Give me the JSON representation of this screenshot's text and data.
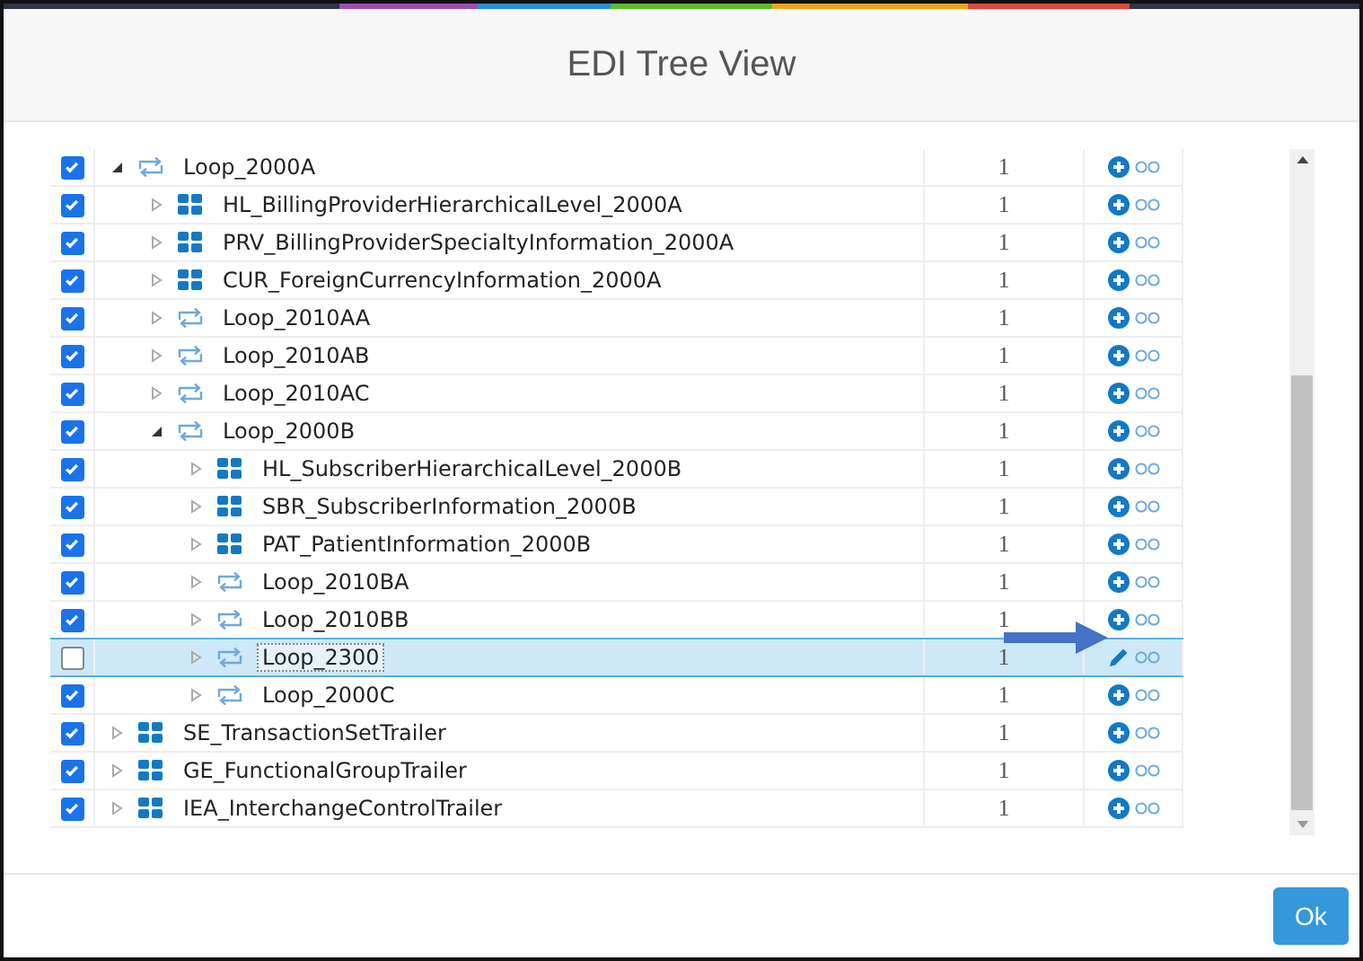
{
  "dialog": {
    "title": "EDI Tree View"
  },
  "tree": [
    {
      "label": "Loop_2000A",
      "kind": "loop",
      "checked": true,
      "expanded": true,
      "selected": false,
      "count": "1",
      "children": [
        {
          "label": "HL_BillingProviderHierarchicalLevel_2000A",
          "kind": "segment",
          "checked": true,
          "expanded": false,
          "selected": false,
          "count": "1"
        },
        {
          "label": "PRV_BillingProviderSpecialtyInformation_2000A",
          "kind": "segment",
          "checked": true,
          "expanded": false,
          "selected": false,
          "count": "1"
        },
        {
          "label": "CUR_ForeignCurrencyInformation_2000A",
          "kind": "segment",
          "checked": true,
          "expanded": false,
          "selected": false,
          "count": "1"
        },
        {
          "label": "Loop_2010AA",
          "kind": "loop",
          "checked": true,
          "expanded": false,
          "selected": false,
          "count": "1"
        },
        {
          "label": "Loop_2010AB",
          "kind": "loop",
          "checked": true,
          "expanded": false,
          "selected": false,
          "count": "1"
        },
        {
          "label": "Loop_2010AC",
          "kind": "loop",
          "checked": true,
          "expanded": false,
          "selected": false,
          "count": "1"
        },
        {
          "label": "Loop_2000B",
          "kind": "loop",
          "checked": true,
          "expanded": true,
          "selected": false,
          "count": "1",
          "children": [
            {
              "label": "HL_SubscriberHierarchicalLevel_2000B",
              "kind": "segment",
              "checked": true,
              "expanded": false,
              "selected": false,
              "count": "1"
            },
            {
              "label": "SBR_SubscriberInformation_2000B",
              "kind": "segment",
              "checked": true,
              "expanded": false,
              "selected": false,
              "count": "1"
            },
            {
              "label": "PAT_PatientInformation_2000B",
              "kind": "segment",
              "checked": true,
              "expanded": false,
              "selected": false,
              "count": "1"
            },
            {
              "label": "Loop_2010BA",
              "kind": "loop",
              "checked": true,
              "expanded": false,
              "selected": false,
              "count": "1"
            },
            {
              "label": "Loop_2010BB",
              "kind": "loop",
              "checked": true,
              "expanded": false,
              "selected": false,
              "count": "1"
            },
            {
              "label": "Loop_2300",
              "kind": "loop",
              "checked": false,
              "expanded": false,
              "selected": true,
              "count": "1"
            },
            {
              "label": "Loop_2000C",
              "kind": "loop",
              "checked": true,
              "expanded": false,
              "selected": false,
              "count": "1"
            }
          ]
        }
      ]
    },
    {
      "label": "SE_TransactionSetTrailer",
      "kind": "segment",
      "checked": true,
      "expanded": false,
      "selected": false,
      "count": "1"
    },
    {
      "label": "GE_FunctionalGroupTrailer",
      "kind": "segment",
      "checked": true,
      "expanded": false,
      "selected": false,
      "count": "1"
    },
    {
      "label": "IEA_InterchangeControlTrailer",
      "kind": "segment",
      "checked": true,
      "expanded": false,
      "selected": false,
      "count": "1"
    }
  ],
  "buttons": [
    "Ok"
  ]
}
